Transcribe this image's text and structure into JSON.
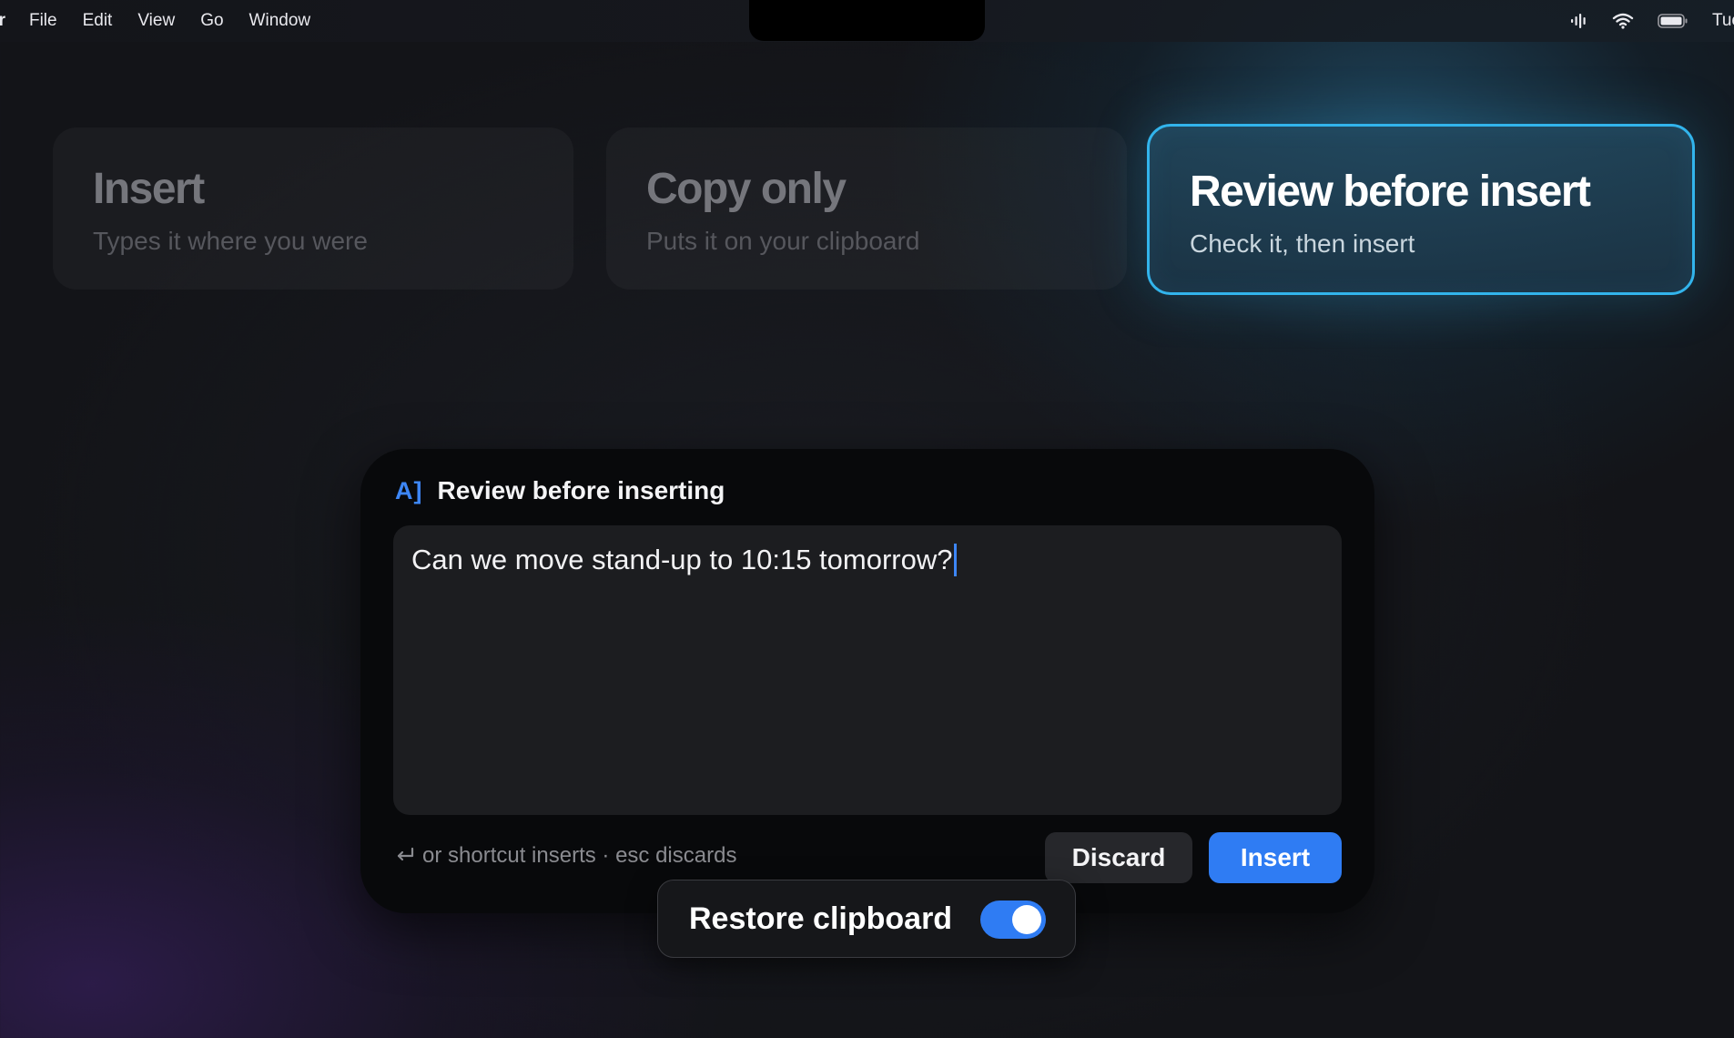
{
  "menubar": {
    "app_name": "er",
    "items": [
      "File",
      "Edit",
      "View",
      "Go",
      "Window"
    ],
    "status_icons": [
      "voice-memo-icon",
      "wifi-icon",
      "battery-icon"
    ],
    "clock": "Tue"
  },
  "modes": [
    {
      "title": "Insert",
      "subtitle": "Types it where you were",
      "selected": false
    },
    {
      "title": "Copy only",
      "subtitle": "Puts it on your clipboard",
      "selected": false
    },
    {
      "title": "Review before insert",
      "subtitle": "Check it, then insert",
      "selected": true
    }
  ],
  "review_panel": {
    "badge": "A]",
    "title": "Review before inserting",
    "text": "Can we move stand-up to 10:15 tomorrow?",
    "hint": "or shortcut inserts · esc discards",
    "hint_icon": "return-icon",
    "discard_label": "Discard",
    "insert_label": "Insert"
  },
  "restore_clipboard": {
    "label": "Restore clipboard",
    "enabled": true
  },
  "colors": {
    "accent_blue": "#2f7cf3",
    "selected_border": "#32b4ec",
    "badge_blue": "#3d86f5"
  }
}
